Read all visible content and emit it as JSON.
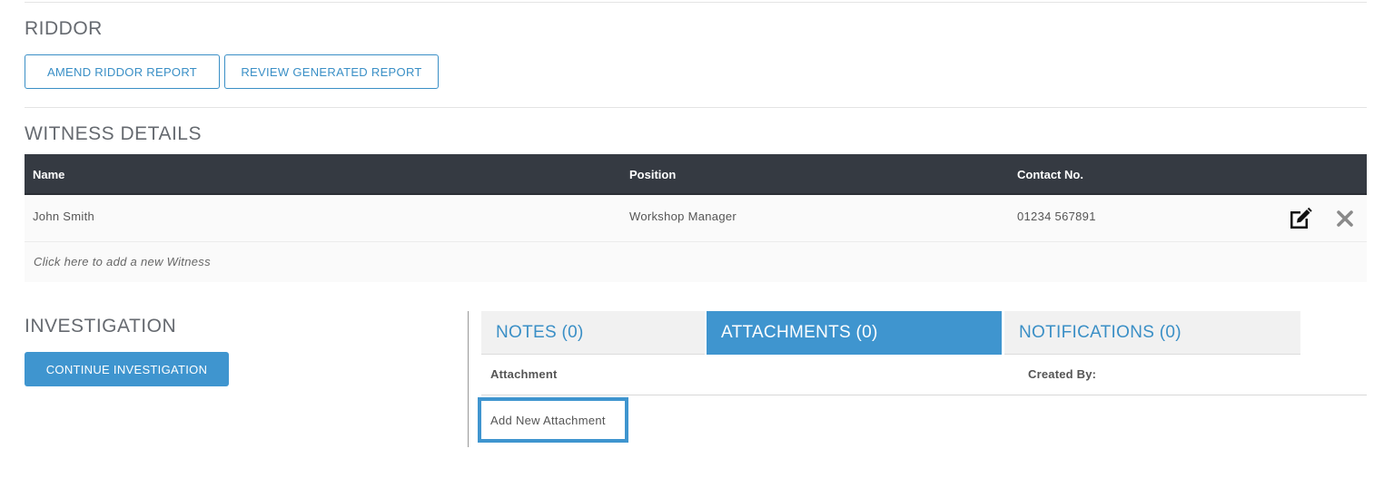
{
  "riddor": {
    "title": "RIDDOR",
    "amend_label": "AMEND RIDDOR REPORT",
    "review_label": "REVIEW GENERATED REPORT"
  },
  "witness": {
    "title": "WITNESS DETAILS",
    "columns": [
      "Name",
      "Position",
      "Contact No."
    ],
    "rows": [
      {
        "name": "John Smith",
        "position": "Workshop Manager",
        "contact": "01234 567891"
      }
    ],
    "add_prompt": "Click here to add a new Witness",
    "icons": {
      "edit": "edit-icon",
      "delete": "close-icon"
    }
  },
  "investigation": {
    "title": "INVESTIGATION",
    "continue_label": "CONTINUE INVESTIGATION"
  },
  "tabs": [
    {
      "label": "NOTES (0)",
      "active": false
    },
    {
      "label": "ATTACHMENTS (0)",
      "active": true
    },
    {
      "label": "NOTIFICATIONS (0)",
      "active": false
    }
  ],
  "attachments": {
    "columns": [
      "Attachment",
      "Created By:"
    ],
    "add_label": "Add New Attachment"
  },
  "colors": {
    "accent": "#3f95cf",
    "table_header": "#353a42"
  }
}
